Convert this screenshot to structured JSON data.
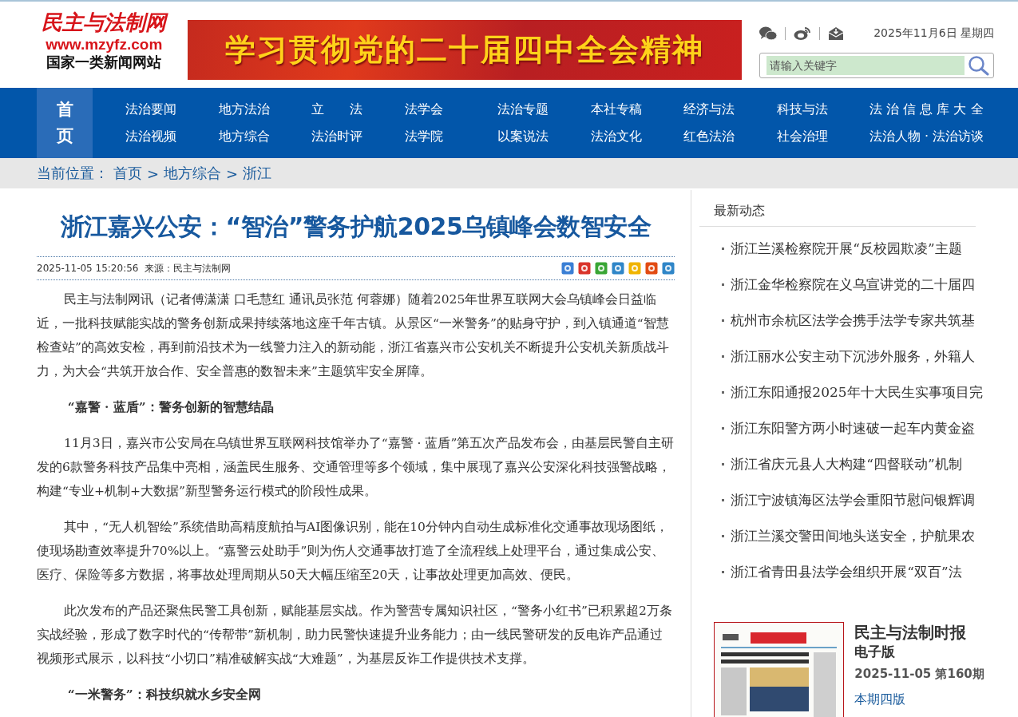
{
  "header": {
    "logo": {
      "name": "民主与法制网",
      "url": "www.mzyfz.com",
      "tagline": "国家一类新闻网站"
    },
    "banner": "学习贯彻党的二十届四中全会精神",
    "date": "2025年11月6日 星期四",
    "search": {
      "placeholder": "请输入关键字"
    }
  },
  "nav": {
    "home": {
      "label": "首页",
      "selected": true
    },
    "items": [
      {
        "label": "法治要闻",
        "selected": false
      },
      {
        "label": "地方法治",
        "selected": false
      },
      {
        "label": "立　　法",
        "selected": false
      },
      {
        "label": "法学会",
        "selected": false
      },
      {
        "label": "法治专题",
        "selected": false
      },
      {
        "label": "本社专稿",
        "selected": false
      },
      {
        "label": "经济与法",
        "selected": false
      },
      {
        "label": "科技与法",
        "selected": false
      },
      {
        "label": "法 治 信 息 库 大 全",
        "selected": false
      },
      {
        "label": "法治视频",
        "selected": false
      },
      {
        "label": "地方综合",
        "selected": false
      },
      {
        "label": "法治时评",
        "selected": false
      },
      {
        "label": "法学院",
        "selected": false
      },
      {
        "label": "以案说法",
        "selected": false
      },
      {
        "label": "法治文化",
        "selected": false
      },
      {
        "label": "红色法治",
        "selected": false
      },
      {
        "label": "社会治理",
        "selected": false
      },
      {
        "label": "法治人物 · 法治访谈",
        "selected": false
      }
    ]
  },
  "breadcrumb": {
    "label": "当前位置：",
    "separator": ">",
    "links": [
      "首页",
      "地方综合",
      "浙江"
    ]
  },
  "article": {
    "title": "浙江嘉兴公安：“智治”警务护航2025乌镇峰会数智安全",
    "datetime": "2025-11-05 15:20:56",
    "source": "来源：民主与法制网",
    "blocks": [
      {
        "kind": "paragraph",
        "text": "民主与法制网讯（记者傅潇潇 口毛慧红 通讯员张范 何蓉娜）随着2025年世界互联网大会乌镇峰会日益临近，一批科技赋能实战的警务创新成果持续落地这座千年古镇。从景区“一米警务”的贴身守护，到入镇通道“智慧检查站”的高效安检，再到前沿技术为一线警力注入的新动能，浙江省嘉兴市公安机关不断提升公安机关新质战斗力，为大会“共筑开放合作、安全普惠的数智未来”主题筑牢安全屏障。"
      },
      {
        "kind": "heading",
        "text": "“嘉警 · 蓝盾”：警务创新的智慧结晶"
      },
      {
        "kind": "paragraph",
        "text": "11月3日，嘉兴市公安局在乌镇世界互联网科技馆举办了“嘉警 · 蓝盾”第五次产品发布会，由基层民警自主研发的6款警务科技产品集中亮相，涵盖民生服务、交通管理等多个领域，集中展现了嘉兴公安深化科技强警战略，构建“专业+机制+大数据”新型警务运行模式的阶段性成果。"
      },
      {
        "kind": "paragraph",
        "text": "其中，“无人机智绘”系统借助高精度航拍与AI图像识别，能在10分钟内自动生成标准化交通事故现场图纸，使现场勘查效率提升70%以上。“嘉警云处助手”则为伤人交通事故打造了全流程线上处理平台，通过集成公安、医疗、保险等多方数据，将事故处理周期从50天大幅压缩至20天，让事故处理更加高效、便民。"
      },
      {
        "kind": "paragraph",
        "text": "此次发布的产品还聚焦民警工具创新，赋能基层实战。作为警营专属知识社区，“警务小红书”已积累超2万条实战经验，形成了数字时代的“传帮带”新机制，助力民警快速提升业务能力；由一线民警研发的反电诈产品通过视频形式展示，以科技“小切口”精准破解实战“大难题”，为基层反诈工作提供技术支撑。"
      },
      {
        "kind": "heading",
        "text": "“一米警务”：科技织就水乡安全网"
      }
    ]
  },
  "sidebar": {
    "title": "最新动态",
    "items": [
      "浙江兰溪检察院开展“反校园欺凌”主题",
      "浙江金华检察院在义乌宣讲党的二十届四",
      "杭州市余杭区法学会携手法学专家共筑基",
      "浙江丽水公安主动下沉涉外服务，外籍人",
      "浙江东阳通报2025年十大民生实事项目完",
      "浙江东阳警方两小时速破一起车内黄金盗",
      "浙江省庆元县人大构建“四督联动”机制",
      "浙江宁波镇海区法学会重阳节慰问银辉调",
      "浙江兰溪交警田间地头送安全，护航果农",
      "浙江省青田县法学会组织开展“双百”法"
    ]
  },
  "epaper": {
    "title": "民主与法制时报",
    "edition": "电子版",
    "issue": "2025-11-05 第160期",
    "link": "本期四版"
  }
}
